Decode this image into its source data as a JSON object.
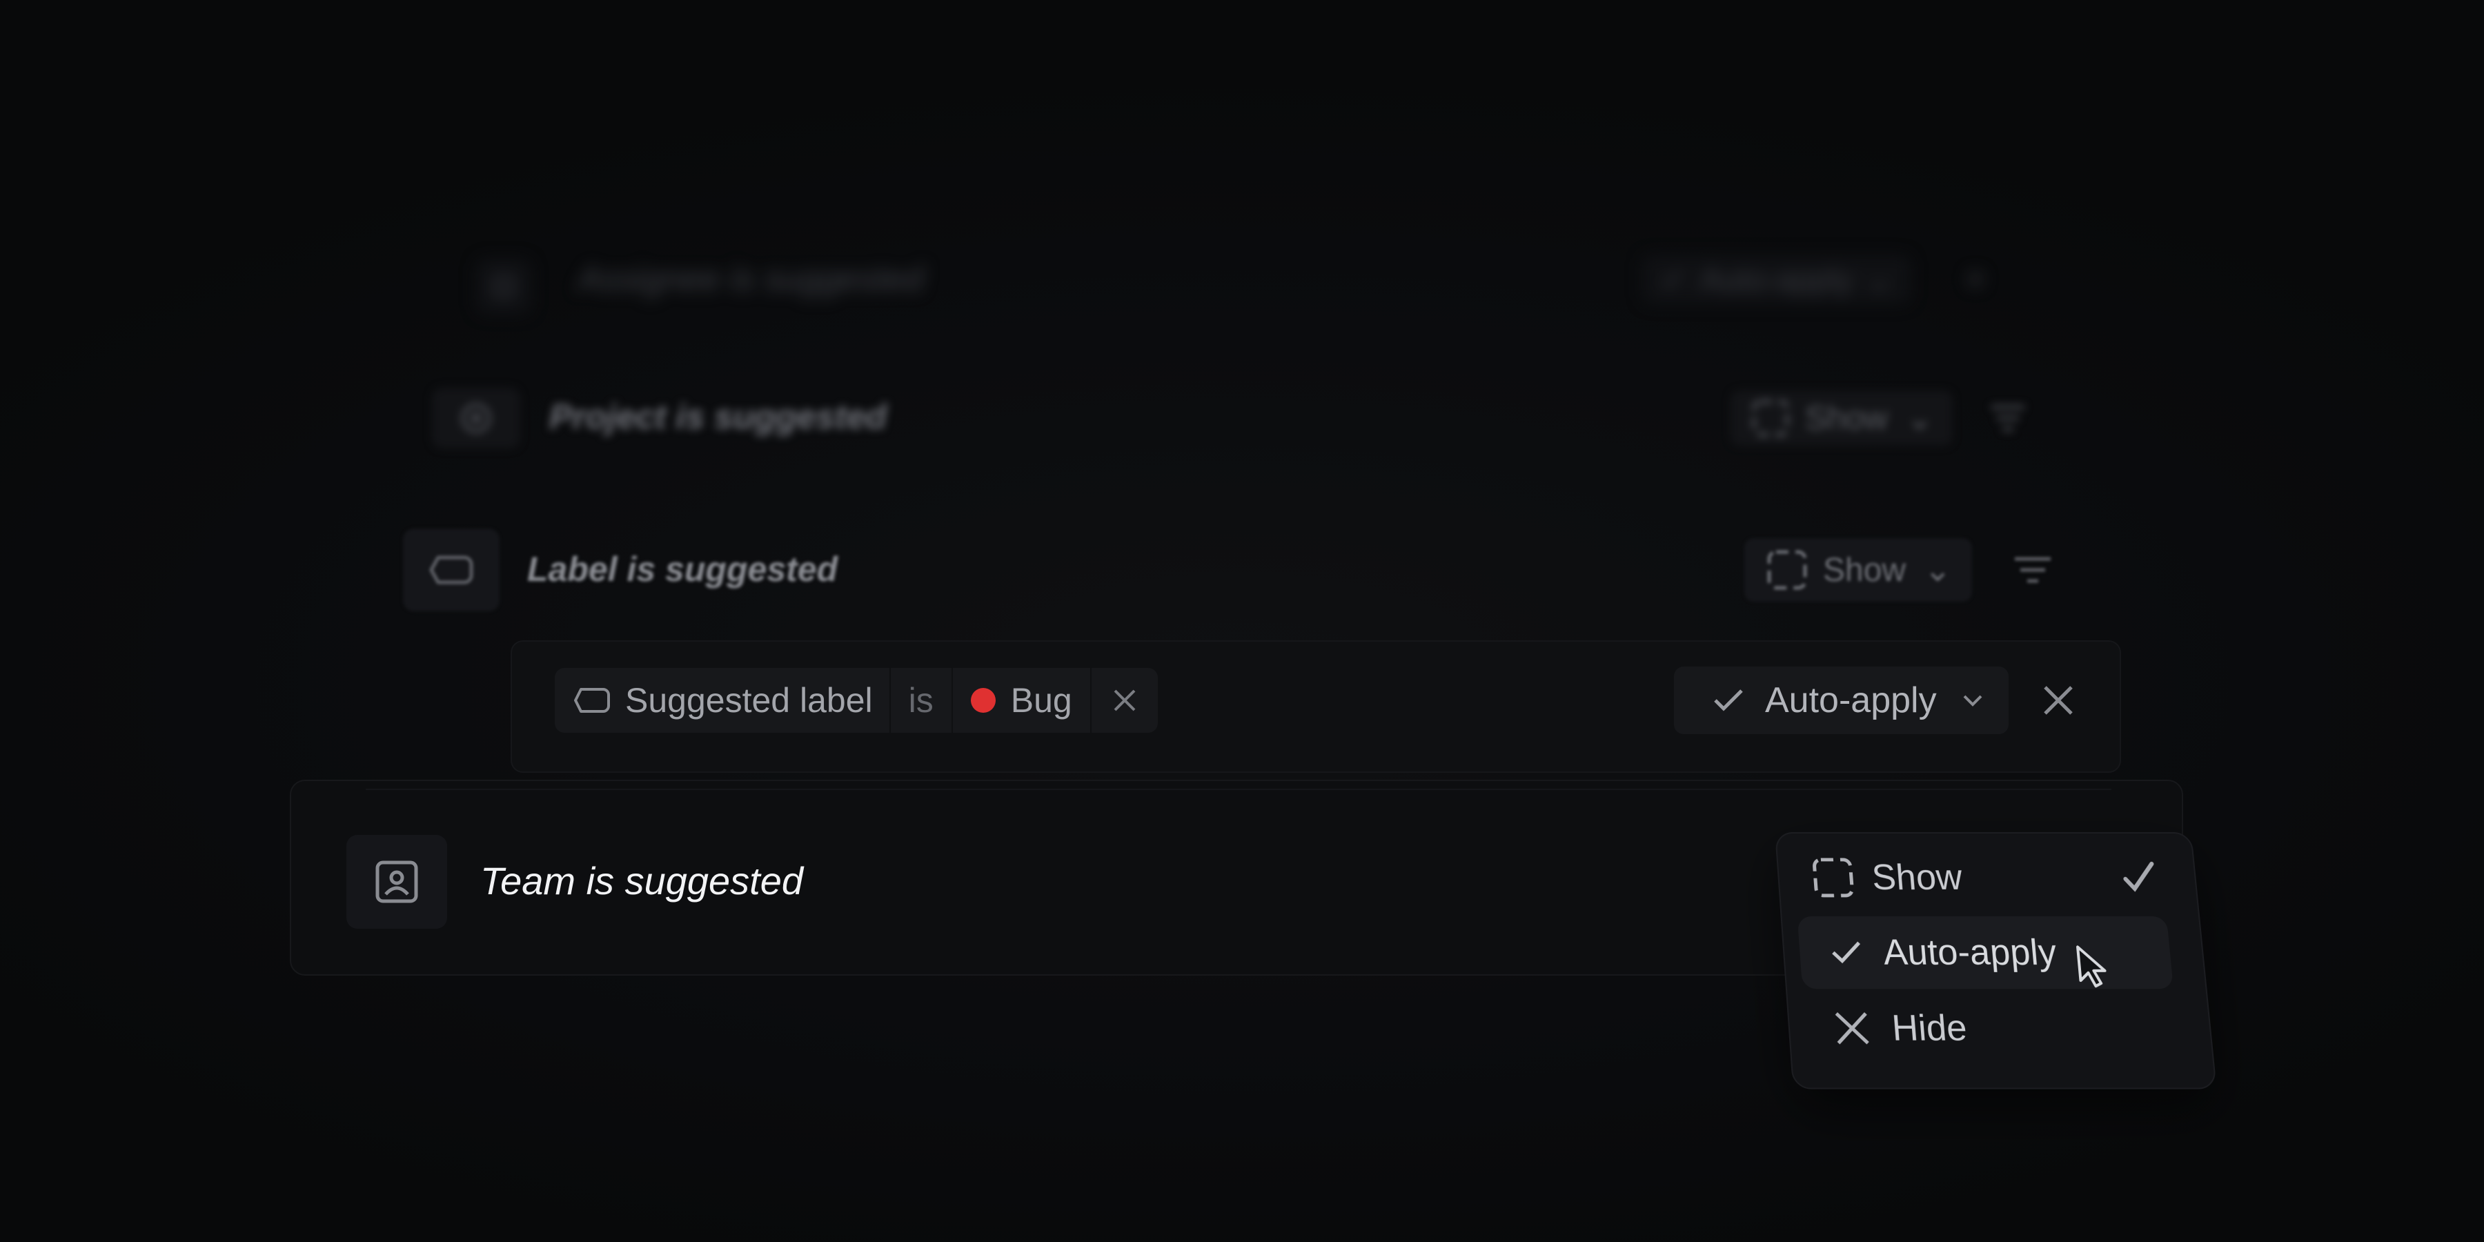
{
  "rows": {
    "assignee": {
      "title": "Assignee is suggested",
      "action_label": "Auto-apply"
    },
    "project": {
      "title": "Project is suggested",
      "action_label": "Show"
    },
    "label": {
      "title": "Label is suggested",
      "action_label": "Show"
    },
    "label_rule": {
      "field": "Suggested label",
      "operator": "is",
      "value": "Bug",
      "value_color": "#e03131",
      "action_label": "Auto-apply"
    },
    "team": {
      "title": "Team is suggested"
    }
  },
  "menu": {
    "items": [
      {
        "label": "Show",
        "icon": "dashed-square-icon",
        "selected": true
      },
      {
        "label": "Auto-apply",
        "icon": "check-icon",
        "highlighted": true
      },
      {
        "label": "Hide",
        "icon": "close-icon"
      }
    ]
  },
  "colors": {
    "background": "#0a0b0d",
    "bug_dot": "#e03131"
  }
}
